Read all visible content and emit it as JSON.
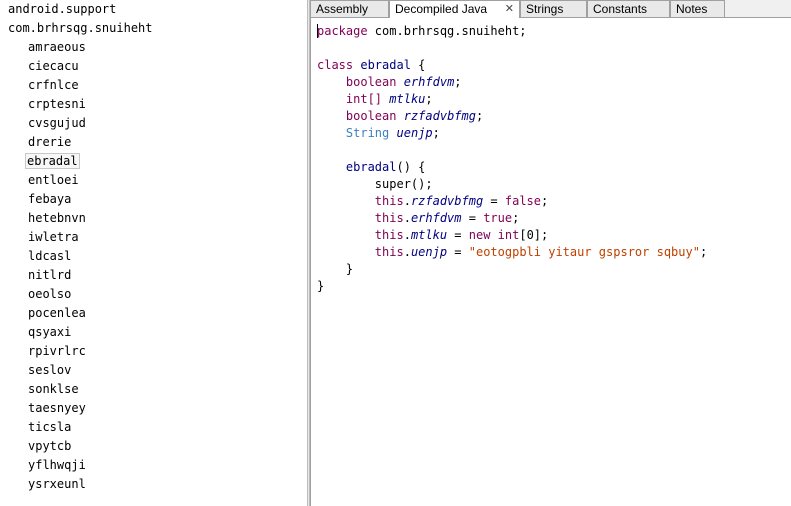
{
  "tree": {
    "packages": [
      "android.support",
      "com.brhrsqg.snuiheht"
    ],
    "classes": [
      "amraeous",
      "ciecacu",
      "crfnlce",
      "crptesni",
      "cvsgujud",
      "drerie",
      "ebradal",
      "entloei",
      "febaya",
      "hetebnvn",
      "iwletra",
      "ldcasl",
      "nitlrd",
      "oeolso",
      "pocenlea",
      "qsyaxi",
      "rpivrlrc",
      "seslov",
      "sonklse",
      "taesnyey",
      "ticsla",
      "vpytcb",
      "yflhwqji",
      "ysrxeunl"
    ],
    "selected": "ebradal"
  },
  "tabs": [
    "Assembly",
    "Decompiled Java",
    "Strings",
    "Constants",
    "Notes"
  ],
  "active_tab": "Decompiled Java",
  "code": {
    "l1_kw": "package",
    "l1_rest": " com.brhrsqg.snuiheht;",
    "l3_kw": "class",
    "l3_name": "ebradal",
    "l3_brace": " {",
    "f1_type": "boolean",
    "f1_name": "erhfdvm",
    "f2_type": "int[]",
    "f2_name": "mtlku",
    "f3_type": "boolean",
    "f3_name": "rzfadvbfmg",
    "f4_type": "String",
    "f4_name": "uenjp",
    "ctor_name": "ebradal",
    "ctor_rest": "() {",
    "super_call": "super();",
    "a1_this": "this",
    "a1_field": "rzfadvbfmg",
    "a1_eq": " = ",
    "a1_val": "false",
    "a2_this": "this",
    "a2_field": "erhfdvm",
    "a2_eq": " = ",
    "a2_val": "true",
    "a3_this": "this",
    "a3_field": "mtlku",
    "a3_eq": " = ",
    "a3_new": "new",
    "a3_int": "int",
    "a3_idx": "[0];",
    "a4_this": "this",
    "a4_field": "uenjp",
    "a4_eq": " = ",
    "a4_val": "\"eotogpbli yitaur gspsror sqbuy\"",
    "semi": ";",
    "ctor_close": "}",
    "class_close": "}"
  },
  "colors": {
    "keyword": "#7f0055",
    "identifier": "#000080",
    "string_type": "#3f7fbf",
    "string_literal": "#c04000"
  }
}
